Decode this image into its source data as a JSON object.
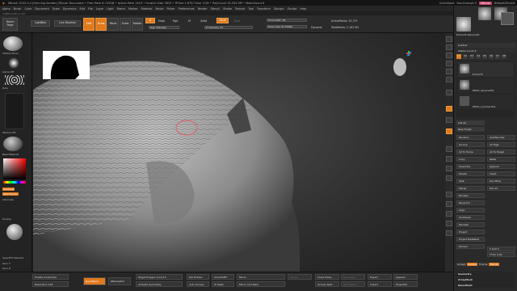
{
  "window": {
    "title": "ZBrush 2022.0.4 [Henning Sander]   ZBrush Document   • Free Mem 6.725GB • Active Mem 2419 • Scratch Disk 3634 • RTime 1.876 Timer 3.08 • PolyCount 51.062 MP • MeshCount 6",
    "quicksave": "QuickSave",
    "see_through": "See-through 0",
    "menus_badge": "Menus",
    "default_script": "DefaultZScript"
  },
  "menubar": [
    "Alpha",
    "Brush",
    "Color",
    "Document",
    "Draw",
    "Dynamics",
    "Edit",
    "File",
    "Layer",
    "Light",
    "Macro",
    "Marker",
    "Material",
    "Movie",
    "Picker",
    "Preferences",
    "Render",
    "Stencil",
    "Stroke",
    "Texture",
    "Tool",
    "Transform",
    "Zplugin",
    "Zscript",
    "Help"
  ],
  "coord": "0.683,-0.252,0.427",
  "topbar": {
    "home": "Home Page",
    "lightbox": "LightBox",
    "live_boolean": "Live Boolean",
    "edit": "Edit",
    "draw": "Draw",
    "move": "Move",
    "scale": "Scale",
    "rotate": "Rotate",
    "a_label": "A",
    "mrgb": "Mrgb",
    "rgb": "Rgb",
    "m": "M",
    "zadd": "Zadd",
    "zsub": "Zsub",
    "zcut": "Zcut",
    "rgb_intensity": "Rgb Intensity",
    "z_intensity": "Z Intensity 23",
    "focal_shift": "Focal Shift -54",
    "draw_size": "Draw Size 47.42062",
    "dynamic": "Dynamic",
    "active_points": "ActivePoints: 50,707",
    "total_points": "TotalPoints: 2.163 Mil"
  },
  "leftpanel": {
    "brush": "hPolish Move",
    "alpha": "Alpha Off",
    "stroke": "Dots",
    "texture": "Texture Off",
    "material": "BasicMaterial",
    "gradient": "Gradient",
    "switch_color": "SwitchColor",
    "alternate": "Alternate",
    "double": "Double",
    "selectfit": "SelectFit SelectLs",
    "zero1": "Zero S",
    "zero2": "Zero R"
  },
  "rightpanel": {
    "ac_shelf": "AC"
  },
  "tray": {
    "tool_name": "Extract5 Sphere3D",
    "subtool": "Subtool",
    "visible_count": "Visible Count 4",
    "tabs": [
      "V1",
      "V2",
      "V3",
      "V4",
      "V5",
      "V6",
      "V7",
      "V8"
    ],
    "items": [
      "Extract5",
      "PM3D_Sphere3D1",
      "PM3D_Cylinder3D1"
    ],
    "list_all": "List All",
    "new_folder": "New Folder",
    "rows_left": [
      "Rename",
      "All Low",
      "All To Home",
      "Copy",
      "Duplicate",
      "Delete",
      "Split",
      "Merge",
      "Boolean",
      "Bevel Pro",
      "Align",
      "Distribute",
      "Remesh",
      "Project",
      "Project BasRelief",
      "Extract"
    ],
    "rows_right": [
      "AutoReorder",
      "All High",
      "All To Target",
      "Paste",
      "Append",
      "Insert",
      "Del Other",
      "Del All"
    ],
    "thick": "Thick 0.02",
    "smooth": "S Smt 5",
    "accept": "Accept",
    "double": "Double",
    "tcorne": "TCorne",
    "tborder": "TBorde",
    "geometry": "Geometry",
    "arraymesh": "ArrayMesh",
    "nanomesh": "NanoMesh"
  },
  "bottombar": {
    "enable_customize": "Enable Customize",
    "resolution": "Resolution 128",
    "dynamesh": "DynaMesh",
    "zremesher": "ZRemesher",
    "target_poly": "Target Polygon Count 5",
    "activate_sym": "Activate Symmetry",
    "del_hidden": "Del Hidden",
    "auto_groups": "Auto Groups",
    "smooth_mt": "SmoothMT",
    "to_mesh": "To Mesh",
    "mirror": "Mirror",
    "mirror_weld": "Mirror And Weld",
    "group_visible": "GrpVis",
    "close_holes": "Close Holes",
    "groups_split": "Groups Split",
    "del_lower": "Del Lower",
    "del_higher": "Del Higher",
    "export": "Export",
    "import": "Import",
    "append": "Append",
    "project_all": "ProjectAll"
  },
  "colors": {
    "accent": "#e07a1e",
    "badge": "#c9456b"
  }
}
